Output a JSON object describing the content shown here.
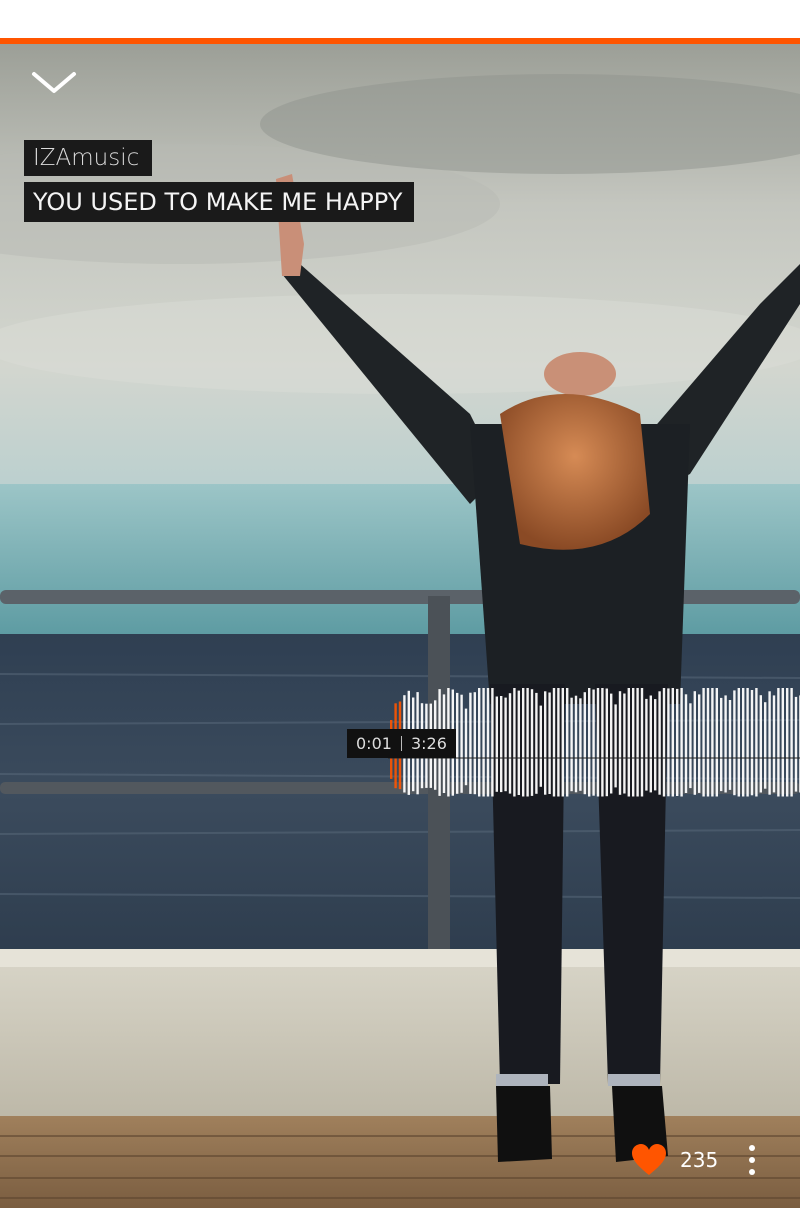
{
  "player": {
    "artist": "IZAmusic",
    "track_title": "YOU USED TO MAKE ME HAPPY",
    "elapsed": "0:01",
    "duration": "3:26",
    "progress_fraction": 0.005,
    "like_count": "235",
    "liked": true
  },
  "icons": {
    "collapse": "chevron-down-icon",
    "like": "heart-icon",
    "more": "more-vertical-icon"
  },
  "colors": {
    "accent": "#ff5500",
    "label_bg": "#1a1a1a",
    "waveform": "#ffffff"
  }
}
